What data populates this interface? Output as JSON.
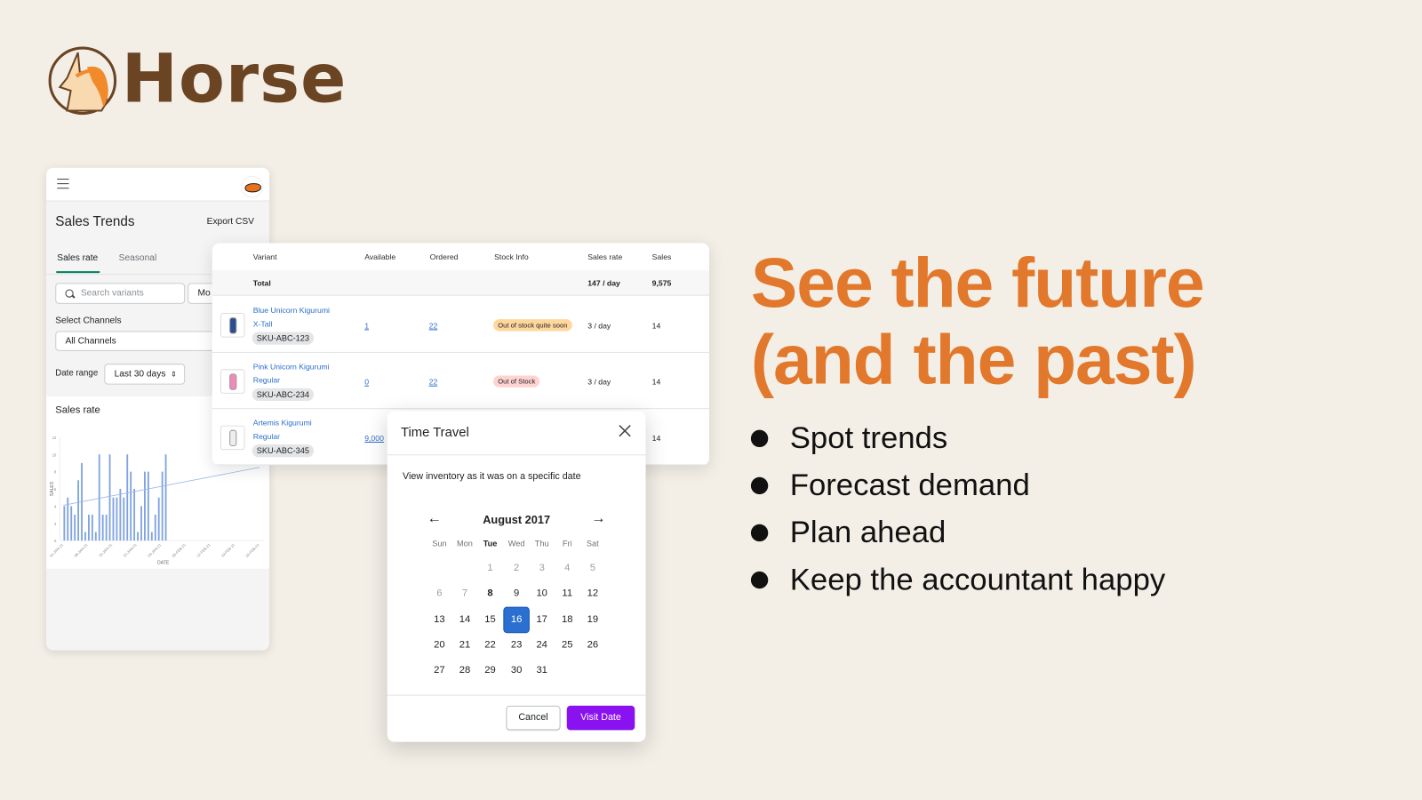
{
  "brand": {
    "name": "Horse"
  },
  "colors": {
    "accent": "#e2782b",
    "brand_brown": "#6b4423",
    "selected_day": "#2b6fd1",
    "primary_button": "#8a11f0",
    "tab_underline": "#008060",
    "bar": "#7fa3e0"
  },
  "panel": {
    "title": "Sales Trends",
    "export": "Export CSV",
    "tabs": [
      {
        "label": "Sales rate",
        "active": true
      },
      {
        "label": "Seasonal",
        "active": false
      }
    ],
    "search_placeholder": "Search variants",
    "more_button": "Mo",
    "channels_label": "Select Channels",
    "channels_value": "All Channels",
    "date_range_label": "Date range",
    "date_range_value": "Last 30 days",
    "chart_title": "Sales rate"
  },
  "chart_data": {
    "type": "bar",
    "ylabel": "SALES",
    "xlabel": "DATE",
    "ylim": [
      0,
      12
    ],
    "yticks": [
      0,
      2,
      4,
      6,
      8,
      10,
      12
    ],
    "xticks": [
      "01-JAN-21",
      "08-JAN-21",
      "15-JAN-21",
      "22-JAN-21",
      "29-JAN-21",
      "05-FEB-21",
      "12-FEB-21",
      "19-FEB-21",
      "26-FEB-21"
    ],
    "values": [
      4,
      5,
      4,
      3,
      7,
      9,
      1,
      3,
      3,
      1,
      10,
      3,
      3,
      10,
      5,
      5,
      6,
      5,
      10,
      8,
      6,
      1,
      4,
      8,
      8,
      1,
      3,
      5,
      8,
      10
    ],
    "trendline": {
      "start": 4.1,
      "end": 8.5
    }
  },
  "table": {
    "headers": [
      "Variant",
      "Available",
      "Ordered",
      "Stock Info",
      "Sales rate",
      "Sales"
    ],
    "total": {
      "label": "Total",
      "sales_rate": "147 / day",
      "sales": "9,575"
    },
    "rows": [
      {
        "name": "Blue Unicorn Kigurumi",
        "variant": "X-Tall",
        "sku": "SKU-ABC-123",
        "available": "1",
        "ordered": "22",
        "stock": "Out of stock quite soon",
        "stock_type": "warning",
        "rate": "3 / day",
        "sales": "14"
      },
      {
        "name": "Pink Unicorn Kigurumi",
        "variant": "Regular",
        "sku": "SKU-ABC-234",
        "available": "0",
        "ordered": "22",
        "stock": "Out of Stock",
        "stock_type": "critical",
        "rate": "3 / day",
        "sales": "14"
      },
      {
        "name": "Artemis Kigurumi",
        "variant": "Regular",
        "sku": "SKU-ABC-345",
        "available": "9,000",
        "ordered": "",
        "stock": "",
        "rate": "",
        "sales": "14"
      }
    ]
  },
  "modal": {
    "title": "Time Travel",
    "subtitle": "View inventory as it was on a specific date",
    "month": "August 2017",
    "weekdays": [
      "Sun",
      "Mon",
      "Tue",
      "Wed",
      "Thu",
      "Fri",
      "Sat"
    ],
    "selected": 16,
    "today": 8,
    "disabled_before": 8,
    "days_in_month": 31,
    "first_weekday": 2,
    "cancel": "Cancel",
    "confirm": "Visit Date"
  },
  "marketing": {
    "headline_1": "See the future",
    "headline_2": "(and the past)",
    "bullets": [
      "Spot trends",
      "Forecast demand",
      "Plan ahead",
      "Keep the accountant happy"
    ]
  }
}
